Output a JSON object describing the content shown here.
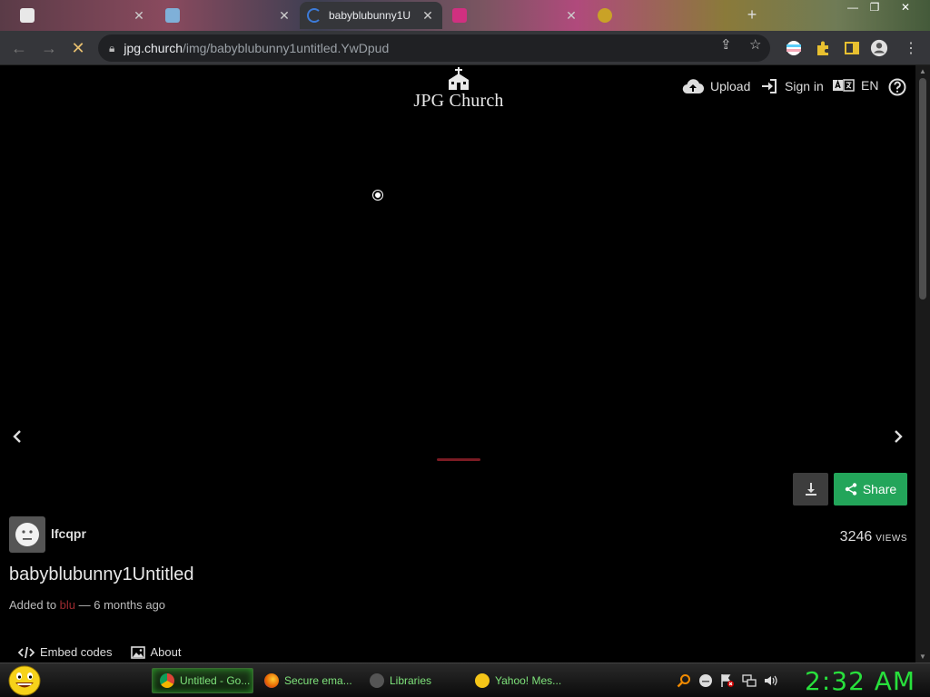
{
  "browser": {
    "tabs": [
      {
        "label": "",
        "favicon_color": "#e8e8e8"
      },
      {
        "label": "",
        "favicon_color": "#7fb0d8"
      },
      {
        "label": "babyblubunny1U",
        "favicon_color": "#3d7bd8"
      },
      {
        "label": "",
        "favicon_color": "#d03080"
      },
      {
        "label": "",
        "favicon_color": "#c9a227"
      }
    ],
    "url_host": "jpg.church",
    "url_path": "/img/babyblubunny1untitled.YwDpud"
  },
  "site": {
    "logo_text": "JPG Church",
    "nav": {
      "upload": "Upload",
      "signin": "Sign in",
      "language": "EN"
    }
  },
  "image": {
    "uploader": "lfcqpr",
    "views_count": "3246",
    "views_label": "VIEWS",
    "title": "babyblubunny1Untitled",
    "added_prefix": "Added to",
    "album": "blu",
    "added_suffix": " — 6 months ago",
    "share_label": "Share",
    "embed_label": "Embed codes",
    "about_label": "About"
  },
  "taskbar": {
    "tasks": [
      {
        "label": "Untitled - Go...",
        "icon_color": "#db4437"
      },
      {
        "label": "Secure ema...",
        "icon_color": "#e66000"
      },
      {
        "label": "Libraries",
        "icon_color": "#555555"
      },
      {
        "label": "Yahoo! Mes...",
        "icon_color": "#f5c518"
      }
    ],
    "clock": "2:32 AM"
  },
  "colors": {
    "accent_share": "#23a55a",
    "album_link": "#9c2a2f",
    "clock": "#28e03c"
  }
}
